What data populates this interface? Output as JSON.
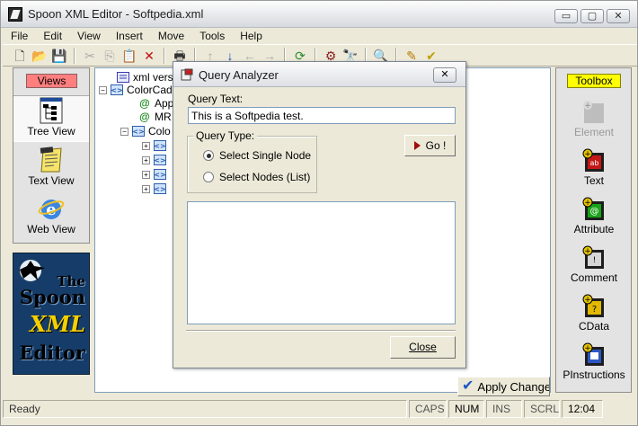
{
  "window": {
    "title": "Spoon XML Editor - Softpedia.xml",
    "caption_buttons": {
      "minimize": "▭",
      "maximize": "▢",
      "close": "✕"
    }
  },
  "menu": [
    "File",
    "Edit",
    "View",
    "Insert",
    "Move",
    "Tools",
    "Help"
  ],
  "toolbar": {
    "buttons": [
      {
        "icon": "new-file-icon",
        "glyph": "🗋"
      },
      {
        "icon": "open-folder-icon",
        "glyph": "📂"
      },
      {
        "icon": "save-icon",
        "glyph": "💾"
      },
      {
        "icon": "cut-icon",
        "glyph": "✂"
      },
      {
        "icon": "copy-icon",
        "glyph": "⎘"
      },
      {
        "icon": "paste-icon",
        "glyph": "📋"
      },
      {
        "icon": "delete-icon",
        "glyph": "✕"
      },
      {
        "icon": "print-icon",
        "glyph": "🖶"
      },
      {
        "icon": "move-up-icon",
        "glyph": "↑"
      },
      {
        "icon": "move-down-icon",
        "glyph": "↓"
      },
      {
        "icon": "move-left-icon",
        "glyph": "←"
      },
      {
        "icon": "move-right-icon",
        "glyph": "→"
      },
      {
        "icon": "refresh-icon",
        "glyph": "⟳"
      },
      {
        "icon": "settings-icon",
        "glyph": "⚙"
      },
      {
        "icon": "find-icon",
        "glyph": "🔭"
      },
      {
        "icon": "query-icon",
        "glyph": "🔍"
      },
      {
        "icon": "edit-icon",
        "glyph": "✎"
      },
      {
        "icon": "validate-icon",
        "glyph": "✔"
      }
    ]
  },
  "views": {
    "label": "Views",
    "items": [
      {
        "label": "Tree View",
        "icon": "tree-view-icon"
      },
      {
        "label": "Text View",
        "icon": "text-view-icon"
      },
      {
        "label": "Web View",
        "icon": "web-view-icon"
      }
    ]
  },
  "logo": {
    "lines": [
      "The",
      "Spoon",
      "XML",
      "Editor"
    ]
  },
  "tree": {
    "nodes": [
      {
        "label": "xml versi",
        "icon": "xml-declaration-icon"
      },
      {
        "label": "ColorCad",
        "icon": "element-icon"
      },
      {
        "label": "App",
        "icon": "attribute-icon"
      },
      {
        "label": "MR",
        "icon": "attribute-icon"
      },
      {
        "label": "Colo",
        "icon": "element-icon"
      },
      {
        "label": "",
        "icon": "element-icon"
      },
      {
        "label": "",
        "icon": "element-icon"
      },
      {
        "label": "",
        "icon": "element-icon"
      },
      {
        "label": "",
        "icon": "element-icon"
      }
    ]
  },
  "toolbox": {
    "label": "Toolbox",
    "items": [
      {
        "label": "Element",
        "icon": "element-add-icon",
        "enabled": false
      },
      {
        "label": "Text",
        "icon": "text-add-icon",
        "enabled": true
      },
      {
        "label": "Attribute",
        "icon": "attribute-add-icon",
        "enabled": true
      },
      {
        "label": "Comment",
        "icon": "comment-add-icon",
        "enabled": true
      },
      {
        "label": "CData",
        "icon": "cdata-add-icon",
        "enabled": true
      },
      {
        "label": "PInstructions",
        "icon": "pi-add-icon",
        "enabled": true
      }
    ]
  },
  "apply_changes": "Apply Changes",
  "status": {
    "ready": "Ready",
    "caps": "CAPS",
    "num": "NUM",
    "ins": "INS",
    "scrl": "SCRL",
    "time": "12:04"
  },
  "dialog": {
    "title": "Query Analyzer",
    "query_text_label": "Query Text:",
    "query_text_value": "This is a Softpedia test.",
    "query_type_label": "Query Type:",
    "options": [
      "Select Single Node",
      "Select Nodes (List)"
    ],
    "selected_option": 0,
    "go_label": "Go !",
    "close_label": "Close"
  },
  "colors": {
    "views_label_bg": "#ff7f7f",
    "toolbox_label_bg": "#ffff00",
    "logo_bg": "#163d69"
  }
}
